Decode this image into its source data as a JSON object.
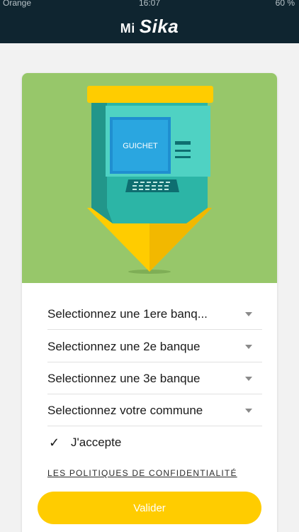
{
  "status_bar": {
    "carrier": "Orange",
    "time": "16:07",
    "battery": "60 %"
  },
  "app": {
    "brand_prefix": "Mi",
    "brand_name": "Sika"
  },
  "hero": {
    "atm_label": "GUICHET",
    "colors": {
      "background": "#97c76a",
      "atm_body": "#2cb5a6",
      "yellow": "#ffcc00"
    }
  },
  "form": {
    "selects": [
      {
        "value": "Selectionnez une 1ere banq..."
      },
      {
        "value": "Selectionnez une 2e banque"
      },
      {
        "value": "Selectionnez une 3e banque"
      },
      {
        "value": "Selectionnez votre commune"
      }
    ],
    "accept": {
      "label": "J'accepte",
      "checked": true
    },
    "policy_link": "LES POLITIQUES DE CONFIDENTIALITÉ",
    "submit_label": "Valider"
  },
  "colors": {
    "appbar": "#0f2530",
    "accent": "#ffcc00"
  }
}
